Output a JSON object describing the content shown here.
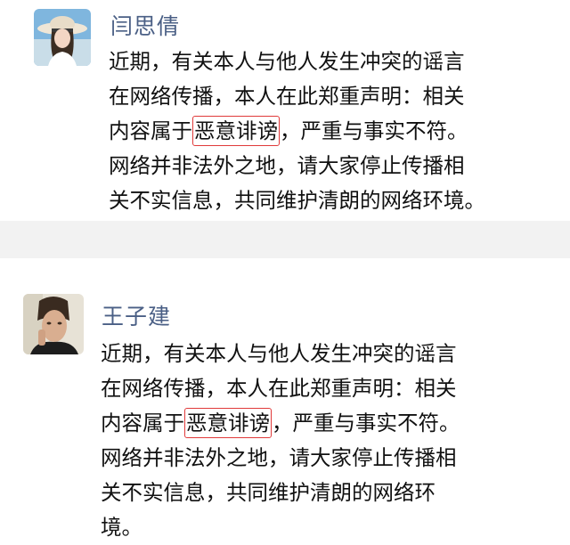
{
  "posts": [
    {
      "author": "闫思倩",
      "lines": [
        {
          "before": "近期，有关本人与他人发生冲突的谣言",
          "highlight": "",
          "after": ""
        },
        {
          "before": "在网络传播，本人在此郑重声明：相关",
          "highlight": "",
          "after": ""
        },
        {
          "before": "内容属于",
          "highlight": "恶意诽谤",
          "after": "，严重与事实不符。"
        },
        {
          "before": "网络并非法外之地，请大家停止传播相",
          "highlight": "",
          "after": ""
        },
        {
          "before": "关不实信息，共同维护清朗的网络环境。",
          "highlight": "",
          "after": ""
        }
      ]
    },
    {
      "author": "王子建",
      "lines": [
        {
          "before": "近期，有关本人与他人发生冲突的谣言",
          "highlight": "",
          "after": ""
        },
        {
          "before": "在网络传播，本人在此郑重声明：相关",
          "highlight": "",
          "after": ""
        },
        {
          "before": "内容属于",
          "highlight": "恶意诽谤",
          "after": "，严重与事实不符。"
        },
        {
          "before": "网络并非法外之地，请大家停止传播相",
          "highlight": "",
          "after": ""
        },
        {
          "before": "关不实信息，共同维护清朗的网络环",
          "highlight": "",
          "after": ""
        },
        {
          "before": "境。",
          "highlight": "",
          "after": ""
        }
      ]
    }
  ],
  "colors": {
    "name": "#4a5f85",
    "highlight_border": "#e03a3a",
    "separator": "#f2f2f2"
  }
}
